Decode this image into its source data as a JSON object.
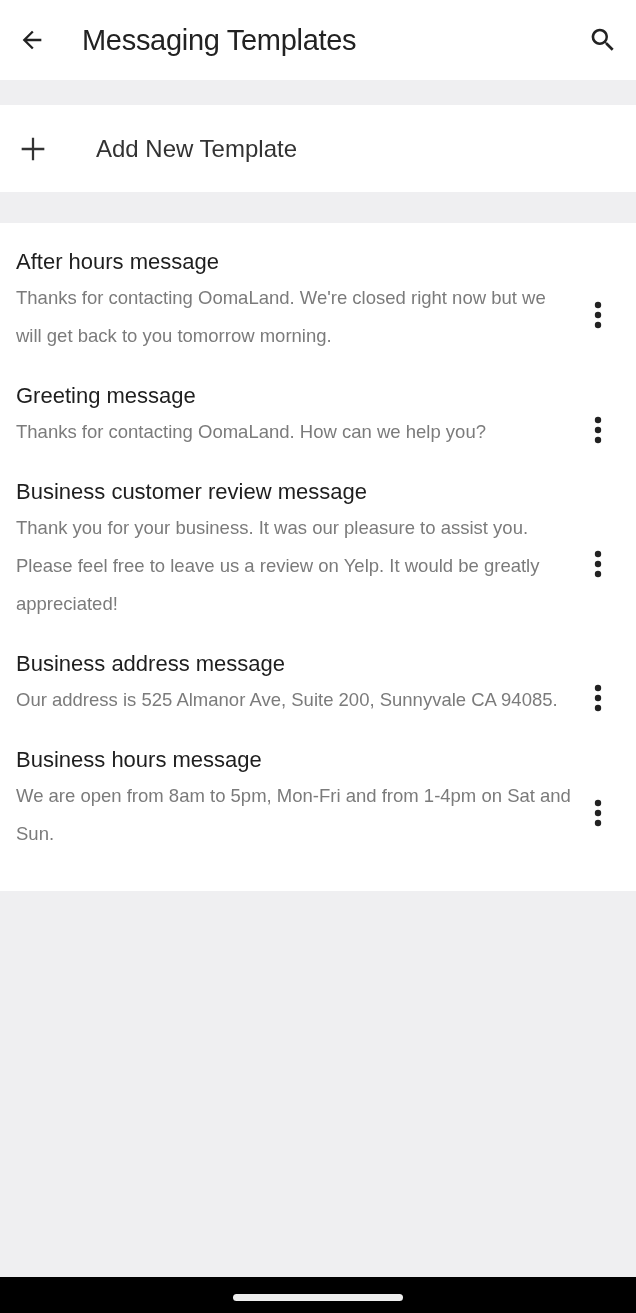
{
  "app_bar": {
    "title": "Messaging Templates"
  },
  "add_action": {
    "label": "Add New Template"
  },
  "templates": [
    {
      "title": "After hours message",
      "preview": "Thanks for contacting OomaLand. We're closed right now but we will get back to you tomorrow morning."
    },
    {
      "title": "Greeting message",
      "preview": "Thanks for contacting OomaLand. How can we help you?"
    },
    {
      "title": "Business customer review message",
      "preview": "Thank you for your business. It was our pleasure to assist you. Please feel free to leave us a review on Yelp. It would be greatly appreciated!"
    },
    {
      "title": "Business address message",
      "preview": "Our address is 525 Almanor Ave, Suite 200, Sunnyvale CA 94085."
    },
    {
      "title": "Business hours message",
      "preview": "We are open from 8am to 5pm, Mon-Fri and from 1-4pm on Sat and Sun."
    }
  ]
}
